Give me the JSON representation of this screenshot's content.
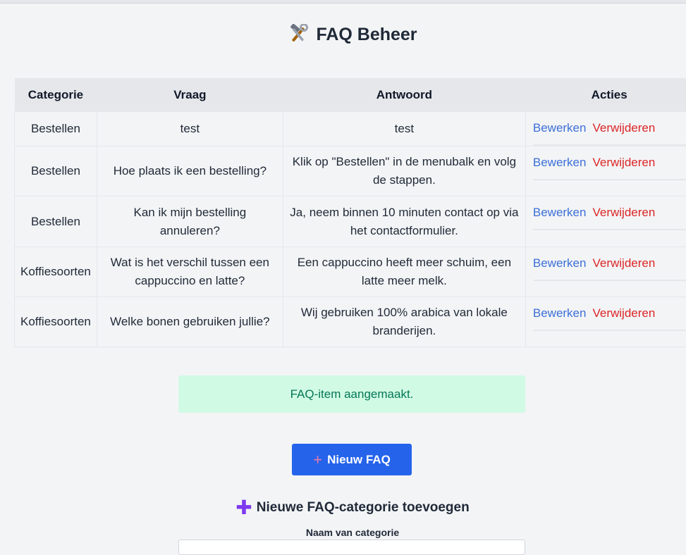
{
  "page": {
    "title": "FAQ Beheer",
    "title_icon": "hammer-and-wrench-icon"
  },
  "table": {
    "headers": [
      "Categorie",
      "Vraag",
      "Antwoord",
      "Acties"
    ],
    "rows": [
      {
        "category": "Bestellen",
        "question": "test",
        "answer": "test"
      },
      {
        "category": "Bestellen",
        "question": "Hoe plaats ik een bestelling?",
        "answer": "Klik op \"Bestellen\" in de menubalk en volg de stappen."
      },
      {
        "category": "Bestellen",
        "question": "Kan ik mijn bestelling annuleren?",
        "answer": "Ja, neem binnen 10 minuten contact op via het contactformulier."
      },
      {
        "category": "Koffiesoorten",
        "question": "Wat is het verschil tussen een cappuccino en latte?",
        "answer": "Een cappuccino heeft meer schuim, een latte meer melk."
      },
      {
        "category": "Koffiesoorten",
        "question": "Welke bonen gebruiken jullie?",
        "answer": "Wij gebruiken 100% arabica van lokale branderijen."
      }
    ],
    "edit_label": "Bewerken",
    "delete_label": "Verwijderen"
  },
  "alert": {
    "message": "FAQ-item aangemaakt."
  },
  "new_button": {
    "label": "Nieuw FAQ",
    "icon": "plus-icon"
  },
  "category_form": {
    "title": "Nieuwe FAQ-categorie toevoegen",
    "name_label": "Naam van categorie",
    "name_value": ""
  },
  "colors": {
    "primary": "#2563eb",
    "edit_link": "#3b6fd6",
    "delete_link": "#dc2626",
    "success_bg": "#d1fae5",
    "success_text": "#047857"
  }
}
